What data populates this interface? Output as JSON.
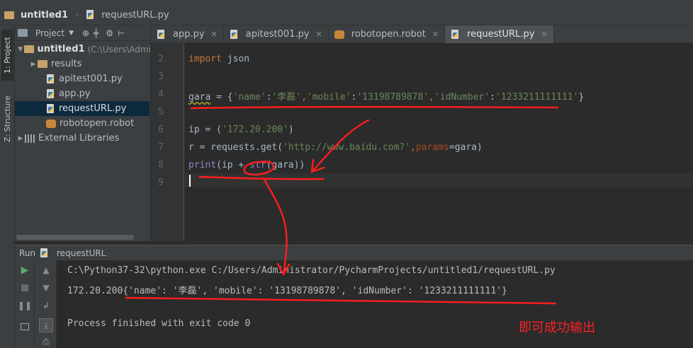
{
  "breadcrumb": {
    "project": "untitled1",
    "file": "requestURL.py"
  },
  "side_tabs": {
    "project": "1: Project",
    "structure": "Z: Structure"
  },
  "project_panel": {
    "title": "Project",
    "root": {
      "name": "untitled1",
      "path": "(C:\\Users\\Admi"
    },
    "items": [
      {
        "label": "results"
      },
      {
        "label": "apitest001.py"
      },
      {
        "label": "app.py"
      },
      {
        "label": "requestURL.py"
      },
      {
        "label": "robotopen.robot"
      }
    ],
    "external": "External Libraries"
  },
  "editor_tabs": [
    {
      "label": "app.py"
    },
    {
      "label": "apitest001.py"
    },
    {
      "label": "robotopen.robot"
    },
    {
      "label": "requestURL.py"
    }
  ],
  "line_numbers": [
    "2",
    "3",
    "4",
    "5",
    "6",
    "7",
    "8",
    "9"
  ],
  "code": {
    "l2_kw": "import",
    "l2_rest": " json",
    "l4_var": "gara",
    "l4_eq": " = {",
    "l4_k1": "'name'",
    "l4_c1": ":",
    "l4_v1": "'李磊'",
    "l4_s1": ",",
    "l4_k2": "'mobile'",
    "l4_c2": ":",
    "l4_v2": "'13198789878'",
    "l4_s2": ",",
    "l4_k3": "'idNumber'",
    "l4_c3": ":",
    "l4_v3": "'1233211111111'",
    "l4_end": "}",
    "l6_pre": "ip = (",
    "l6_str": "'172.20.200'",
    "l6_post": ")",
    "l7_pre": "r = requests.get(",
    "l7_str": "'http://www.baidu.com?'",
    "l7_mid": ",",
    "l7_param": "params",
    "l7_post": "=gara)",
    "l8_print": "print",
    "l8_mid": "(ip + ",
    "l8_str": "str",
    "l8_post": "(gara))"
  },
  "run": {
    "label": "Run",
    "config": "requestURL",
    "out1": "C:\\Python37-32\\python.exe C:/Users/Administrator/PycharmProjects/untitled1/requestURL.py",
    "out2": "172.20.200{'name': '李磊', 'mobile': '13198789878', 'idNumber': '1233211111111'}",
    "out3": "Process finished with exit code 0"
  },
  "annotation": {
    "text": "即可成功输出",
    "color": "#ff2222"
  },
  "colors": {
    "keyword": "#cc7832",
    "string": "#6a8759",
    "builtin": "#8888c6",
    "param": "#aa4926"
  }
}
